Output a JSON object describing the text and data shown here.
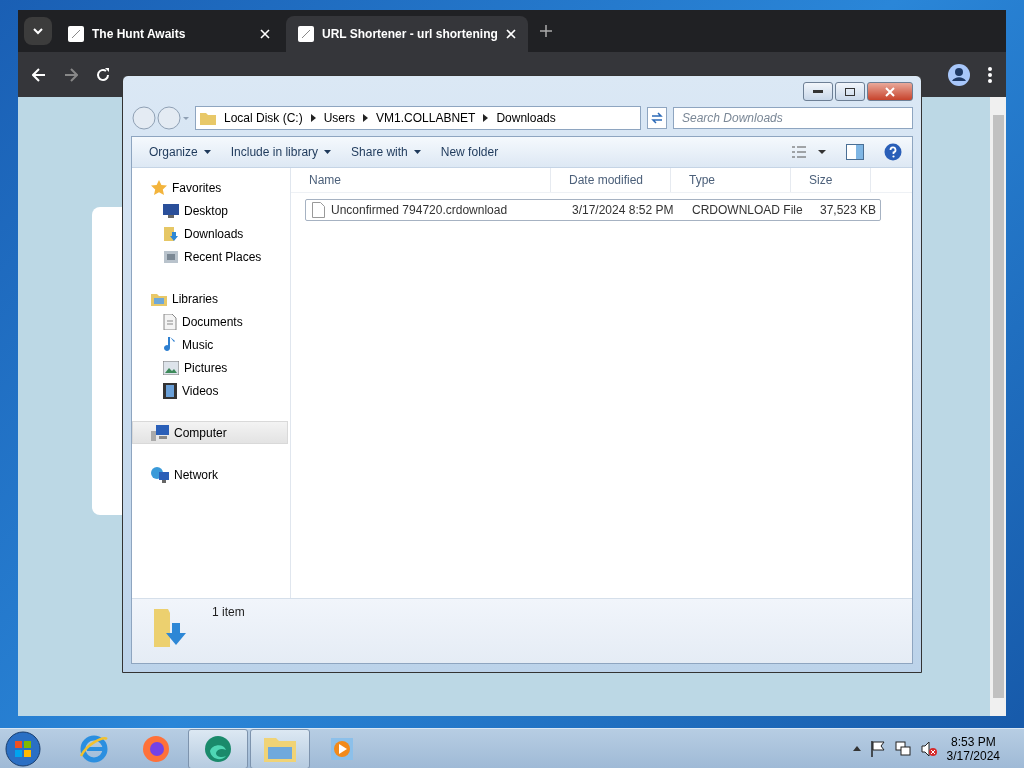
{
  "browser": {
    "tabs": [
      {
        "title": "The Hunt Awaits",
        "selected": false
      },
      {
        "title": "URL Shortener - url shortening",
        "selected": true
      }
    ]
  },
  "explorer": {
    "breadcrumb": [
      "Local Disk (C:)",
      "Users",
      "VM1.COLLABNET",
      "Downloads"
    ],
    "search": {
      "placeholder": "Search Downloads"
    },
    "commands": [
      {
        "label": "Organize",
        "dropdown": true
      },
      {
        "label": "Include in library",
        "dropdown": true
      },
      {
        "label": "Share with",
        "dropdown": true
      },
      {
        "label": "New folder",
        "dropdown": false
      }
    ],
    "nav": [
      {
        "label": "Favorites",
        "kind": "star",
        "selected": false,
        "children": [
          {
            "label": "Desktop",
            "kind": "desktop",
            "selected": false
          },
          {
            "label": "Downloads",
            "kind": "downloads",
            "selected": false
          },
          {
            "label": "Recent Places",
            "kind": "recent",
            "selected": false
          }
        ]
      },
      {
        "label": "Libraries",
        "kind": "library",
        "selected": false,
        "children": [
          {
            "label": "Documents",
            "kind": "document",
            "selected": false
          },
          {
            "label": "Music",
            "kind": "music",
            "selected": false
          },
          {
            "label": "Pictures",
            "kind": "pictures",
            "selected": false
          },
          {
            "label": "Videos",
            "kind": "videos",
            "selected": false
          }
        ]
      },
      {
        "label": "Computer",
        "kind": "computer",
        "selected": true
      },
      {
        "label": "Network",
        "kind": "network",
        "selected": false
      }
    ],
    "columns": [
      "Name",
      "Date modified",
      "Type",
      "Size"
    ],
    "rows": [
      {
        "name": "Unconfirmed 794720.crdownload",
        "date": "3/17/2024 8:52 PM",
        "type": "CRDOWNLOAD File",
        "size": "37,523 KB",
        "selected": true
      }
    ],
    "status": "1 item"
  },
  "taskbar": {
    "apps": [
      {
        "kind": "ie",
        "active": false
      },
      {
        "kind": "firefox",
        "active": false
      },
      {
        "kind": "edge",
        "active": true
      },
      {
        "kind": "explorer",
        "active": true
      },
      {
        "kind": "media",
        "active": false
      }
    ],
    "time": "8:53 PM",
    "date": "3/17/2024"
  }
}
